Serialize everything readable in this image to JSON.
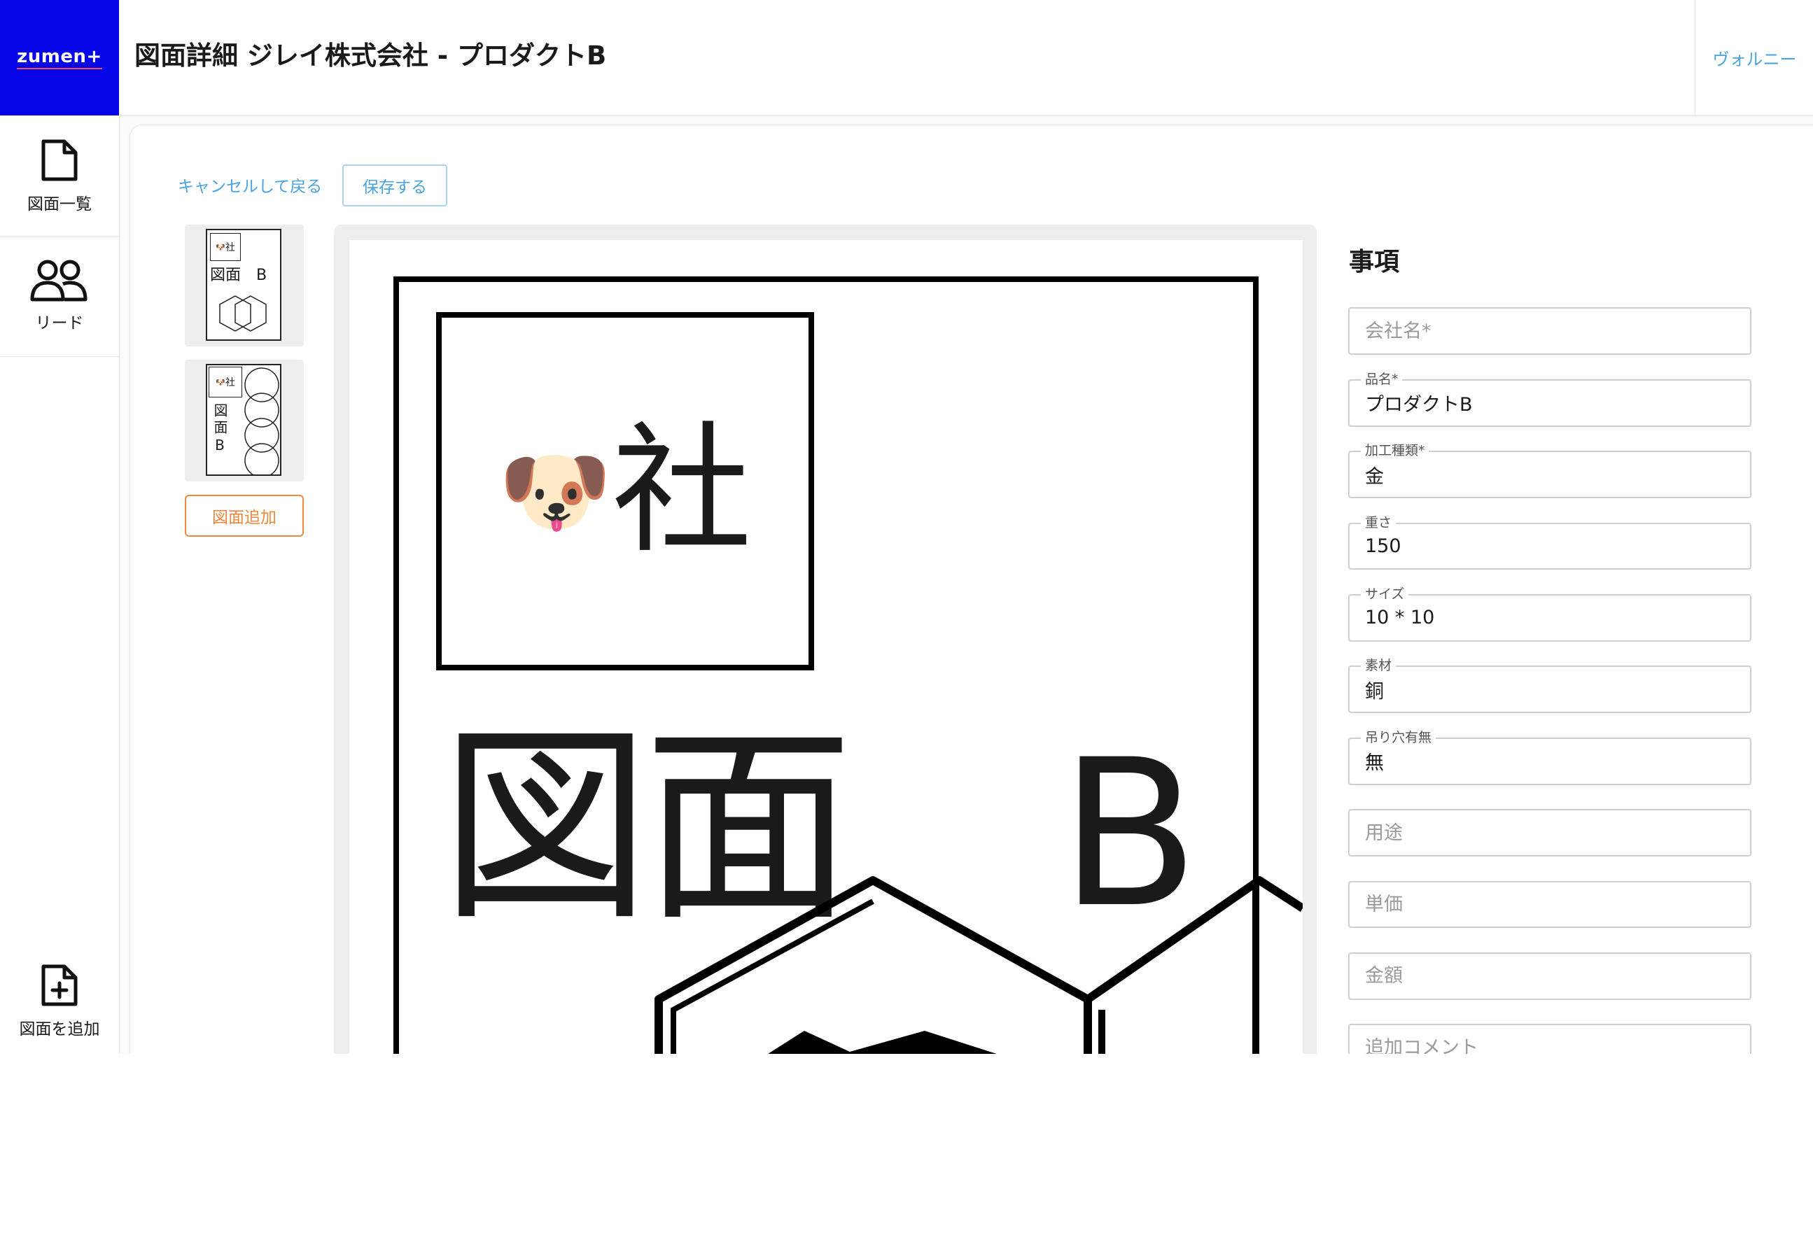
{
  "app": {
    "logo": "zumen+"
  },
  "header": {
    "title": "図面詳細 ジレイ株式会社 - プロダクトB",
    "user": "ヴォルニー"
  },
  "sidebar": {
    "items": [
      {
        "label": "図面一覧",
        "icon": "document-icon"
      },
      {
        "label": "リード",
        "icon": "users-icon"
      }
    ],
    "bottom": {
      "label": "図面を追加",
      "icon": "document-add-icon"
    }
  },
  "toolbar": {
    "cancel_label": "キャンセルして戻る",
    "save_label": "保存する"
  },
  "thumbnails": {
    "items": [
      {
        "logo": "社",
        "text": "図面　B"
      },
      {
        "logo": "社",
        "text": "図面B"
      }
    ],
    "add_label": "図面追加"
  },
  "drawing": {
    "logo_text": "社",
    "title": "図面",
    "letter": "B"
  },
  "form": {
    "title": "事項",
    "fields": [
      {
        "label": "会社名*",
        "value": "",
        "placeholder": "会社名*"
      },
      {
        "label": "品名*",
        "value": "プロダクトB",
        "placeholder": ""
      },
      {
        "label": "加工種類*",
        "value": "金",
        "placeholder": ""
      },
      {
        "label": "重さ",
        "value": "150",
        "placeholder": ""
      },
      {
        "label": "サイズ",
        "value": "10 * 10",
        "placeholder": ""
      },
      {
        "label": "素材",
        "value": "銅",
        "placeholder": ""
      },
      {
        "label": "吊り穴有無",
        "value": "無",
        "placeholder": ""
      },
      {
        "label": "用途",
        "value": "",
        "placeholder": "用途"
      },
      {
        "label": "単価",
        "value": "",
        "placeholder": "単価"
      },
      {
        "label": "金額",
        "value": "",
        "placeholder": "金額"
      },
      {
        "label": "追加コメント",
        "value": "",
        "placeholder": "追加コメント"
      }
    ]
  },
  "colors": {
    "brand": "#0606e6",
    "link": "#4aa3df",
    "accent": "#f0873e"
  }
}
